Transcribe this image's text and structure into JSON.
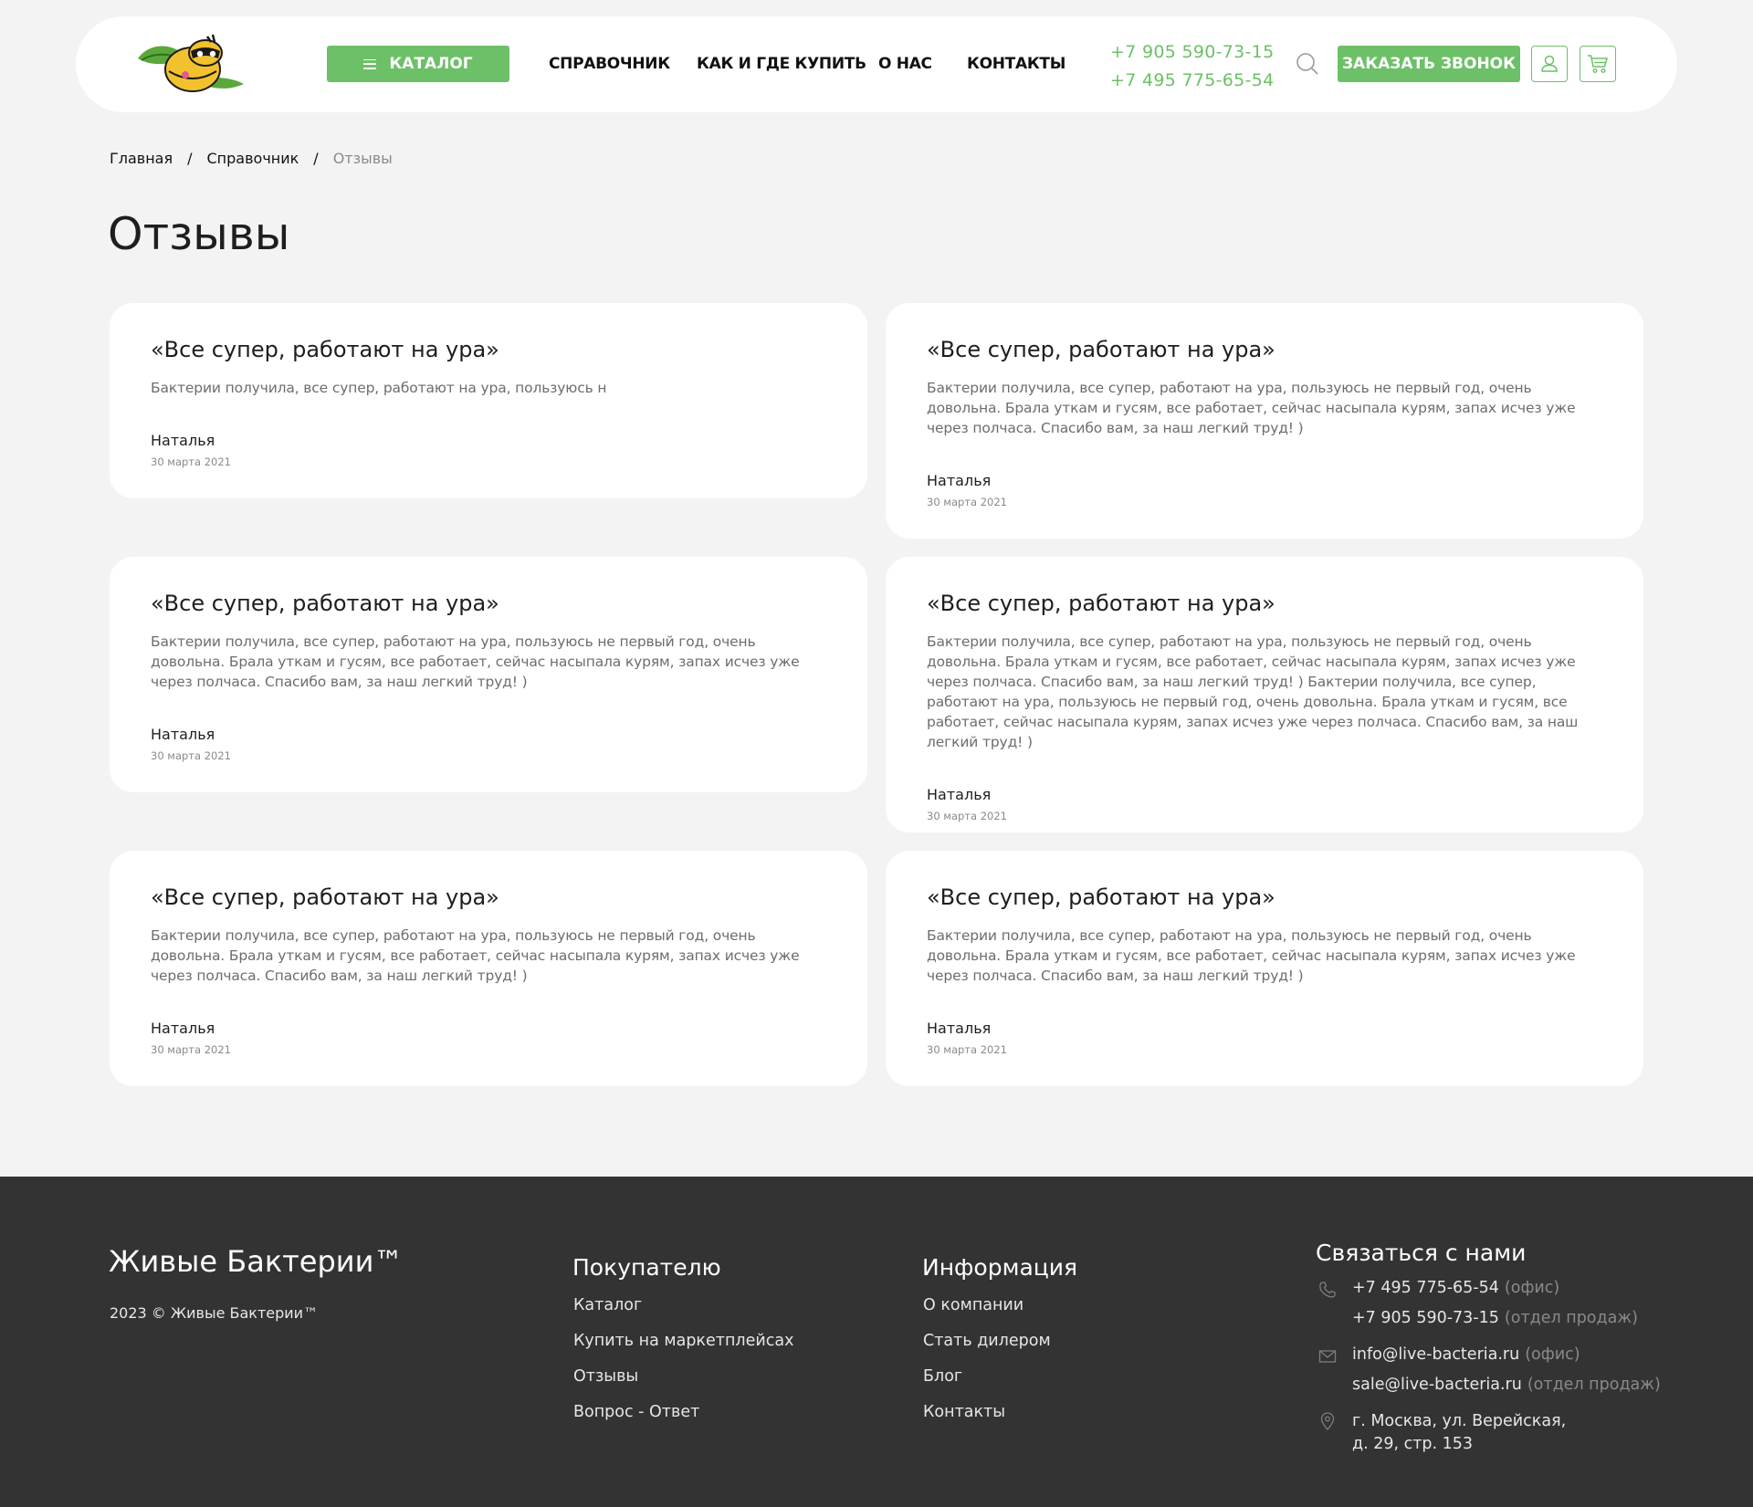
{
  "header": {
    "catalog_label": "КАТАЛОГ",
    "nav": [
      "СПРАВОЧНИК",
      "КАК И ГДЕ КУПИТЬ",
      "О НАС",
      "КОНТАКТЫ"
    ],
    "phones": [
      "+7 905 590-73-15",
      "+7 495 775-65-54"
    ],
    "call_label": "ЗАКАЗАТЬ ЗВОНОК"
  },
  "breadcrumb": [
    "Главная",
    "Справочник",
    "Отзывы"
  ],
  "page_title": "Отзывы",
  "reviews": [
    {
      "title": "«Все супер, работают на ура»",
      "text": "Бактерии получила, все супер, работают на ура, пользуюсь н",
      "author": "Наталья",
      "date": "30 марта 2021"
    },
    {
      "title": "«Все супер, работают на ура»",
      "text": "Бактерии получила, все супер, работают на ура, пользуюсь не первый год, очень довольна. Брала уткам и гусям, все работает, сейчас насыпала курям, запах исчез уже через полчаса. Спасибо вам, за наш легкий труд! )",
      "author": "Наталья",
      "date": "30 марта 2021"
    },
    {
      "title": "«Все супер, работают на ура»",
      "text": "Бактерии получила, все супер, работают на ура, пользуюсь не первый год, очень довольна. Брала уткам и гусям, все работает, сейчас насыпала курям, запах исчез уже через полчаса. Спасибо вам, за наш легкий труд! )",
      "author": "Наталья",
      "date": "30 марта 2021"
    },
    {
      "title": "«Все супер, работают на ура»",
      "text": "Бактерии получила, все супер, работают на ура, пользуюсь не первый год, очень довольна. Брала уткам и гусям, все работает, сейчас насыпала курям, запах исчез уже через полчаса. Спасибо вам, за наш легкий труд! ) Бактерии получила, все супер, работают на ура, пользуюсь не первый год, очень довольна. Брала уткам и гусям, все работает, сейчас насыпала курям, запах исчез уже через полчаса. Спасибо вам, за наш легкий труд! )",
      "author": "Наталья",
      "date": "30 марта 2021"
    },
    {
      "title": "«Все супер, работают на ура»",
      "text": "Бактерии получила, все супер, работают на ура, пользуюсь не первый год, очень довольна. Брала уткам и гусям, все работает, сейчас насыпала курям, запах исчез уже через полчаса. Спасибо вам, за наш легкий труд! )",
      "author": "Наталья",
      "date": "30 марта 2021"
    },
    {
      "title": "«Все супер, работают на ура»",
      "text": "Бактерии получила, все супер, работают на ура, пользуюсь не первый год, очень довольна. Брала уткам и гусям, все работает, сейчас насыпала курям, запах исчез уже через полчаса. Спасибо вам, за наш легкий труд! )",
      "author": "Наталья",
      "date": "30 марта 2021"
    }
  ],
  "footer": {
    "brand": "Живые Бактерии™",
    "copyright": "2023 © Живые Бактерии™",
    "buyer": {
      "title": "Покупателю",
      "links": [
        "Каталог",
        "Купить на маркетплейсах",
        "Отзывы",
        "Вопрос - Ответ"
      ]
    },
    "info": {
      "title": "Информация",
      "links": [
        "О компании",
        "Стать дилером",
        "Блог",
        "Контакты"
      ]
    },
    "contact": {
      "title": "Связаться с нами",
      "phone_office": "+7 495 775-65-54",
      "phone_office_note": "(офис)",
      "phone_sales": "+7 905 590-73-15",
      "phone_sales_note": "(отдел продаж)",
      "email_office": "info@live-bacteria.ru",
      "email_office_note": "(офис)",
      "email_sales": "sale@live-bacteria.ru",
      "email_sales_note": "(отдел продаж)",
      "address_line1": "г. Москва, ул. Верейская,",
      "address_line2": "д. 29, стр. 153"
    }
  },
  "colors": {
    "accent": "#6cc067",
    "footer_bg": "#333333",
    "page_bg": "#f3f3f3"
  },
  "icons": [
    "logo-mascot",
    "menu-icon",
    "search-icon",
    "user-icon",
    "cart-icon",
    "phone-icon",
    "mail-icon",
    "location-icon"
  ]
}
